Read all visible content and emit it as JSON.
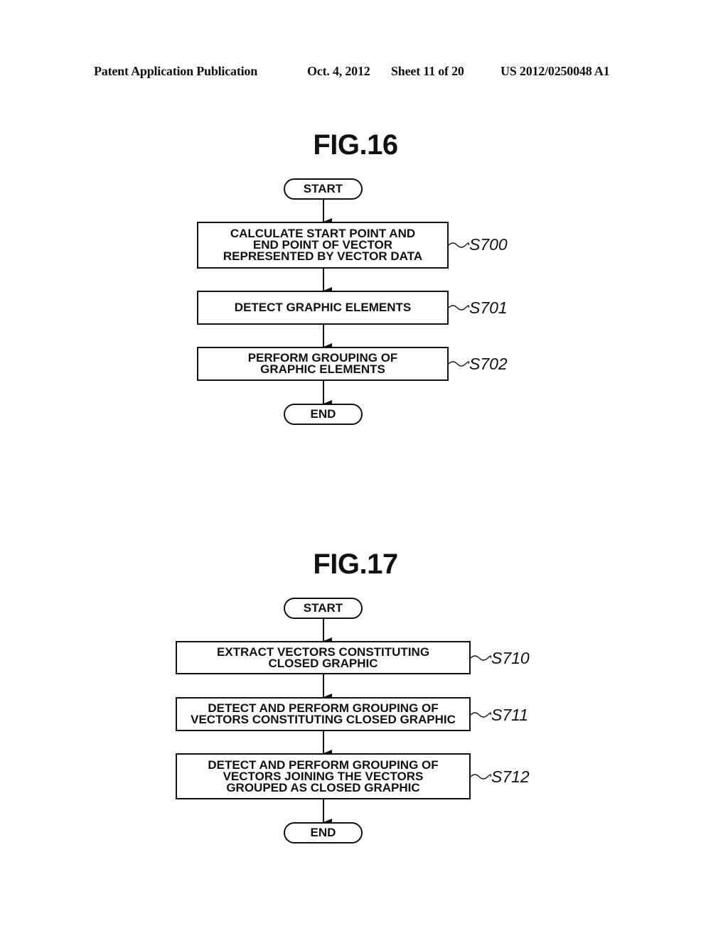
{
  "header": {
    "publication": "Patent Application Publication",
    "date": "Oct. 4, 2012",
    "sheet": "Sheet 11 of 20",
    "number": "US 2012/0250048 A1"
  },
  "figures": [
    {
      "title": "FIG.16",
      "start": "START",
      "end": "END",
      "steps": [
        {
          "id": "S700",
          "text": "CALCULATE START POINT AND\nEND POINT OF VECTOR\nREPRESENTED BY VECTOR DATA"
        },
        {
          "id": "S701",
          "text": "DETECT GRAPHIC ELEMENTS"
        },
        {
          "id": "S702",
          "text": "PERFORM GROUPING OF\nGRAPHIC ELEMENTS"
        }
      ]
    },
    {
      "title": "FIG.17",
      "start": "START",
      "end": "END",
      "steps": [
        {
          "id": "S710",
          "text": "EXTRACT VECTORS CONSTITUTING\nCLOSED GRAPHIC"
        },
        {
          "id": "S711",
          "text": "DETECT AND PERFORM GROUPING OF\nVECTORS CONSTITUTING CLOSED GRAPHIC"
        },
        {
          "id": "S712",
          "text": "DETECT AND PERFORM GROUPING OF\nVECTORS JOINING THE VECTORS\nGROUPED AS CLOSED GRAPHIC"
        }
      ]
    }
  ]
}
